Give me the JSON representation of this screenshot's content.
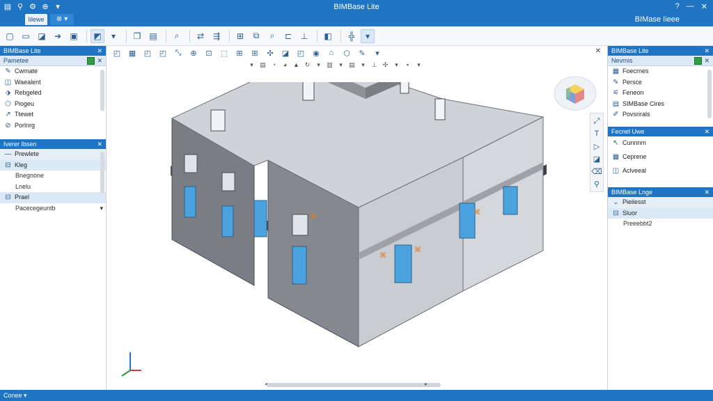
{
  "app": {
    "title": "BIMBase Lite",
    "right_title": "BIMase Iieee",
    "tab_label": "Iilewe",
    "window_controls": [
      "?",
      "—",
      "✕"
    ]
  },
  "toolbar_icons": [
    "new-icon",
    "open-icon",
    "save-icon",
    "export-icon",
    "print-icon",
    "select-icon",
    "copy-icon",
    "paste-icon",
    "zoom-icon",
    "move-icon",
    "copy-move-icon",
    "measure-icon",
    "dimension-icon",
    "axis-icon",
    "view-icon",
    "grid-icon",
    "filter-icon"
  ],
  "left_panel": {
    "title": "BIMBase Lite",
    "sub_header": "Pametee",
    "items": [
      {
        "label": "Cwmate",
        "icon": "pencil-icon"
      },
      {
        "label": "Waealent",
        "icon": "wall-icon"
      },
      {
        "label": "Rebgeled",
        "icon": "rebar-icon"
      },
      {
        "label": "Piogeu",
        "icon": "layer-icon"
      },
      {
        "label": "Ttewet",
        "icon": "brush-icon"
      },
      {
        "label": "Porlnrg",
        "icon": "link-icon"
      }
    ],
    "lower_title": "Iverer Ibsen",
    "lower_items": [
      {
        "label": "Prewlete",
        "style": "hl2"
      },
      {
        "label": "Kleg",
        "style": "hl"
      },
      {
        "label": "Bnegnone",
        "style": "sub"
      },
      {
        "label": "Lnelu",
        "style": "sub"
      },
      {
        "label": "Prael",
        "style": "hl"
      },
      {
        "label": "Pacecegeuntb",
        "style": "sub"
      }
    ]
  },
  "right_panel": {
    "title": "BIMBase Lite",
    "sub_header": "Nevrnis",
    "items": [
      "Foecrnes",
      "Persce",
      "Feneon",
      "SIMBase Cires",
      "Povsrirals"
    ],
    "section2_title": "Fecnel Uwe",
    "section2_items": [
      "Cunnnm",
      "Ceprene",
      "Aclveeal"
    ],
    "section3_title": "BIMBase Lnge",
    "section3_items": [
      "Pieilesst",
      "Sluor",
      "Preeebbt2"
    ]
  },
  "status": {
    "text": "Conee"
  },
  "colors": {
    "accent": "#1f74c4",
    "panel_hl": "#dbe9f7"
  }
}
